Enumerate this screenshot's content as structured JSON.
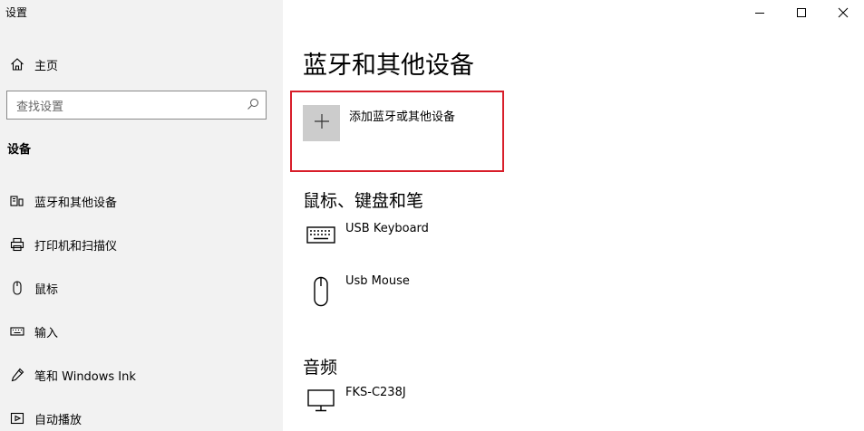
{
  "window": {
    "app_title": "设置",
    "minimize_icon": "minimize-icon",
    "maximize_icon": "maximize-icon",
    "close_icon": "close-icon"
  },
  "sidebar": {
    "home_label": "主页",
    "search_placeholder": "查找设置",
    "section_title": "设备",
    "items": [
      {
        "label": "蓝牙和其他设备",
        "icon": "bluetooth-devices-icon"
      },
      {
        "label": "打印机和扫描仪",
        "icon": "printer-icon"
      },
      {
        "label": "鼠标",
        "icon": "mouse-icon"
      },
      {
        "label": "输入",
        "icon": "keyboard-icon"
      },
      {
        "label": "笔和 Windows Ink",
        "icon": "pen-icon"
      },
      {
        "label": "自动播放",
        "icon": "autoplay-icon"
      }
    ]
  },
  "main": {
    "title": "蓝牙和其他设备",
    "add_device_label": "添加蓝牙或其他设备",
    "groups": [
      {
        "title": "鼠标、键盘和笔",
        "devices": [
          {
            "name": "USB Keyboard",
            "icon": "keyboard-icon"
          },
          {
            "name": "Usb Mouse",
            "icon": "mouse-icon"
          }
        ]
      },
      {
        "title": "音频",
        "devices": [
          {
            "name": "FKS-C238J",
            "icon": "monitor-icon"
          }
        ]
      }
    ]
  },
  "colors": {
    "sidebar_bg": "#f2f2f2",
    "highlight_border": "#d81e2a",
    "add_tile_bg": "#cccccc"
  }
}
